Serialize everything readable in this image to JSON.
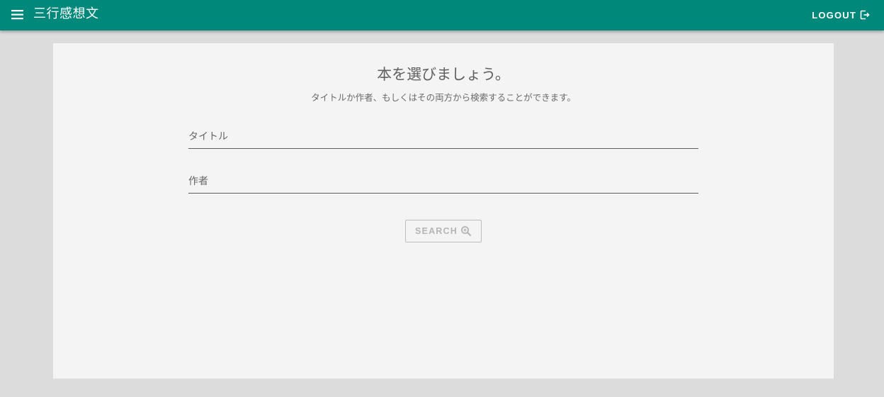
{
  "app": {
    "title": "三行感想文",
    "logout_label": "LOGOUT"
  },
  "main": {
    "heading": "本を選びましょう。",
    "subheading": "タイトルか作者、もしくはその両方から検索することができます。",
    "fields": {
      "title": {
        "placeholder": "タイトル",
        "value": ""
      },
      "author": {
        "placeholder": "作者",
        "value": ""
      }
    },
    "search_label": "SEARCH",
    "search_enabled": false
  },
  "icons": {
    "menu": "menu-icon",
    "logout": "logout-icon",
    "search": "search-zoom-icon"
  },
  "colors": {
    "primary": "#00897b",
    "background": "#dcdcdc",
    "card": "#f4f4f4",
    "disabled_text": "#b5b5b5"
  }
}
